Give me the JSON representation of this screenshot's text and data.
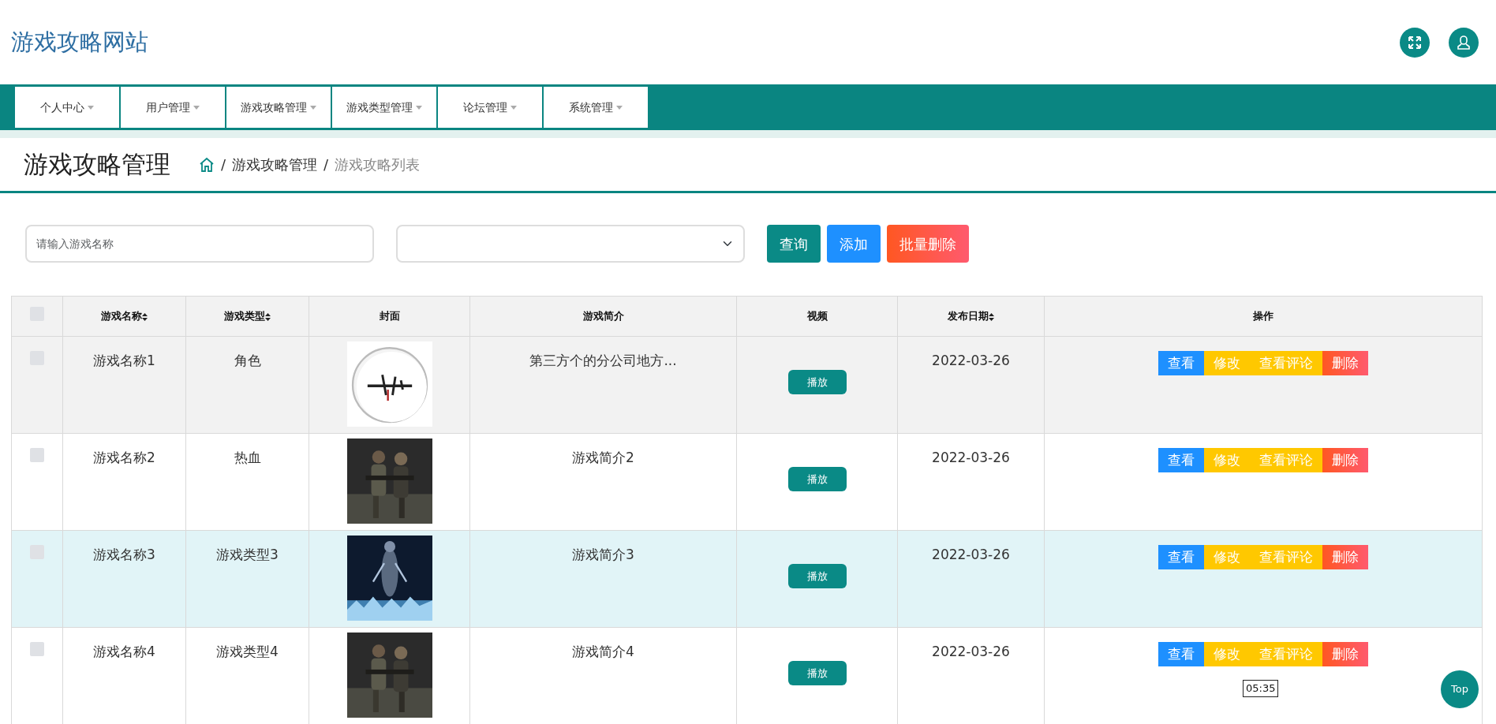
{
  "site_title": "游戏攻略网站",
  "nav": [
    {
      "label": "个人中心"
    },
    {
      "label": "用户管理"
    },
    {
      "label": "游戏攻略管理"
    },
    {
      "label": "游戏类型管理"
    },
    {
      "label": "论坛管理"
    },
    {
      "label": "系统管理"
    }
  ],
  "page_title": "游戏攻略管理",
  "breadcrumb": [
    {
      "separator": "/",
      "label": "游戏攻略管理",
      "current": false
    },
    {
      "separator": "/",
      "label": "游戏攻略列表",
      "current": true
    }
  ],
  "search": {
    "placeholder": "请输入游戏名称"
  },
  "buttons": [
    {
      "label": "查询",
      "kind": "query"
    },
    {
      "label": "添加",
      "kind": "add"
    },
    {
      "label": "批量删除",
      "kind": "delete"
    }
  ],
  "table": {
    "header_checked": false,
    "columns": [
      {
        "label": "游戏名称",
        "sortable": true
      },
      {
        "label": "游戏类型",
        "sortable": true
      },
      {
        "label": "封面",
        "sortable": false
      },
      {
        "label": "游戏简介",
        "sortable": false
      },
      {
        "label": "视频",
        "sortable": false
      },
      {
        "label": "发布日期",
        "sortable": true
      },
      {
        "label": "操作",
        "sortable": false
      }
    ],
    "rows": [
      {
        "checked": false,
        "hovered": true,
        "name": "游戏名称1",
        "type": "角色",
        "intro": "第三方个的分公司地方...",
        "video": "播放",
        "date": "2022-03-26",
        "actions": [
          {
            "label": "查看",
            "kind": "view"
          },
          {
            "label": "修改",
            "kind": "edit"
          },
          {
            "label": "查看评论",
            "kind": "edit"
          },
          {
            "label": "删除",
            "kind": "delete"
          }
        ]
      },
      {
        "checked": false,
        "hovered": false,
        "name": "游戏名称2",
        "type": "热血",
        "intro": "游戏简介2",
        "video": "播放",
        "date": "2022-03-26",
        "actions": [
          {
            "label": "查看",
            "kind": "view"
          },
          {
            "label": "修改",
            "kind": "edit"
          },
          {
            "label": "查看评论",
            "kind": "edit"
          },
          {
            "label": "删除",
            "kind": "delete"
          }
        ]
      },
      {
        "checked": false,
        "hovered": false,
        "name": "游戏名称3",
        "type": "游戏类型3",
        "intro": "游戏简介3",
        "video": "播放",
        "date": "2022-03-26",
        "actions": [
          {
            "label": "查看",
            "kind": "view"
          },
          {
            "label": "修改",
            "kind": "edit"
          },
          {
            "label": "查看评论",
            "kind": "edit"
          },
          {
            "label": "删除",
            "kind": "delete"
          }
        ]
      },
      {
        "checked": false,
        "hovered": false,
        "name": "游戏名称4",
        "type": "游戏类型4",
        "intro": "游戏简介4",
        "video": "播放",
        "date": "2022-03-26",
        "actions": [
          {
            "label": "查看",
            "kind": "view"
          },
          {
            "label": "修改",
            "kind": "edit"
          },
          {
            "label": "查看评论",
            "kind": "edit"
          },
          {
            "label": "删除",
            "kind": "delete"
          }
        ]
      }
    ]
  },
  "tooltip": "05:35",
  "top_button": "Top"
}
